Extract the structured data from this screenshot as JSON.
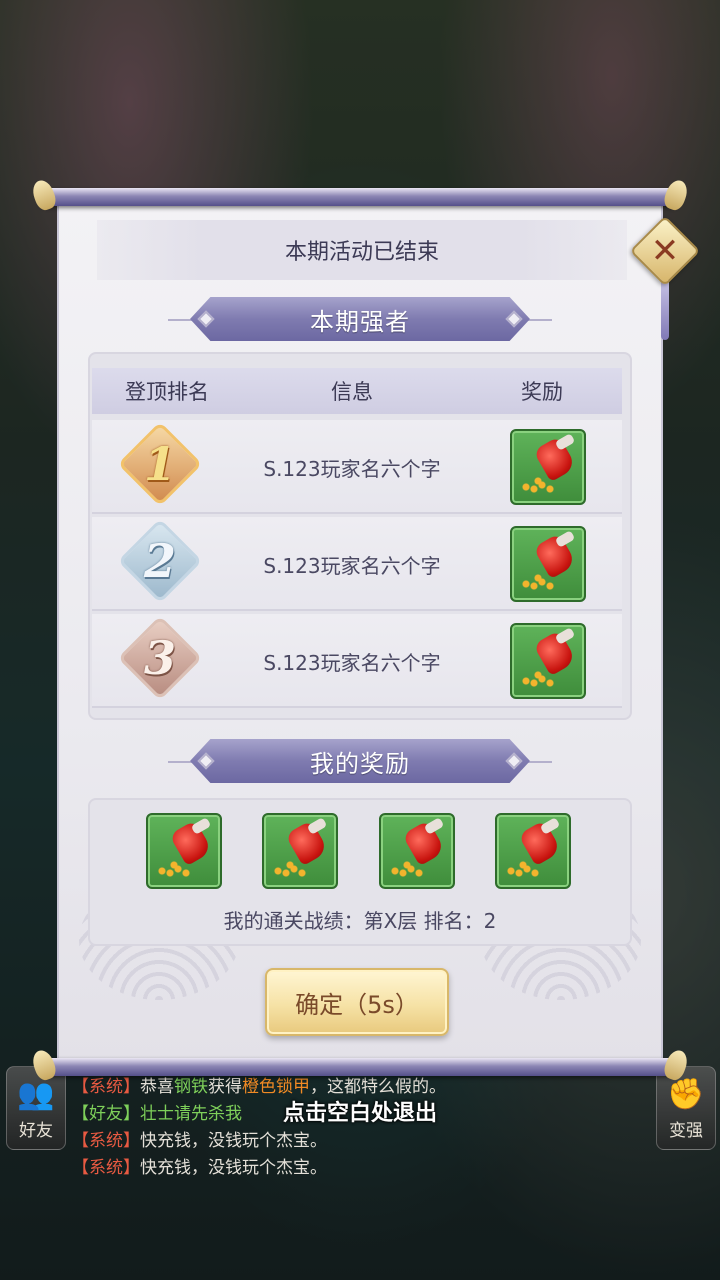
{
  "dialog": {
    "header": "本期活动已结束",
    "top_players_banner": "本期强者",
    "my_rewards_banner": "我的奖励",
    "confirm_label": "确定（5s）",
    "close_symbol": "✕"
  },
  "ranking": {
    "columns": {
      "rank": "登顶排名",
      "info": "信息",
      "reward": "奖励"
    },
    "rows": [
      {
        "rank": "1",
        "player": "S.123玩家名六个字",
        "reward_icon": "red-pouch-with-gold-coins-icon"
      },
      {
        "rank": "2",
        "player": "S.123玩家名六个字",
        "reward_icon": "red-pouch-with-gold-coins-icon"
      },
      {
        "rank": "3",
        "player": "S.123玩家名六个字",
        "reward_icon": "red-pouch-with-gold-coins-icon"
      }
    ]
  },
  "my_rewards": {
    "items": [
      "red-pouch-with-gold-coins-icon",
      "red-pouch-with-gold-coins-icon",
      "red-pouch-with-gold-coins-icon",
      "red-pouch-with-gold-coins-icon"
    ],
    "stats": "我的通关战绩：第X层 排名：2"
  },
  "exit_hint": "点击空白处退出",
  "side_buttons": {
    "friends": "好友",
    "stronger": "变强"
  },
  "chat": [
    {
      "tag": "【系统】",
      "pre": "恭喜",
      "name": "钢铁",
      "mid": "获得",
      "item": "橙色锁甲",
      "post": "，这都特么假的。"
    },
    {
      "tag": "【好友】",
      "pre": "",
      "name": "壮士请先杀我",
      "mid": "",
      "item": "",
      "post": ""
    },
    {
      "tag": "【系统】",
      "pre": "快充钱，没钱玩个杰宝。",
      "name": "",
      "mid": "",
      "item": "",
      "post": ""
    },
    {
      "tag": "【系统】",
      "pre": "快充钱，没钱玩个杰宝。",
      "name": "",
      "mid": "",
      "item": "",
      "post": ""
    }
  ],
  "colors": {
    "banner": "#7f7bb0",
    "reward_tile": "#4fa04a",
    "confirm_button": "#f6e2a6",
    "system_tag": "#e85a42",
    "friend_tag": "#7ed05a",
    "item_orange": "#f08a24"
  }
}
